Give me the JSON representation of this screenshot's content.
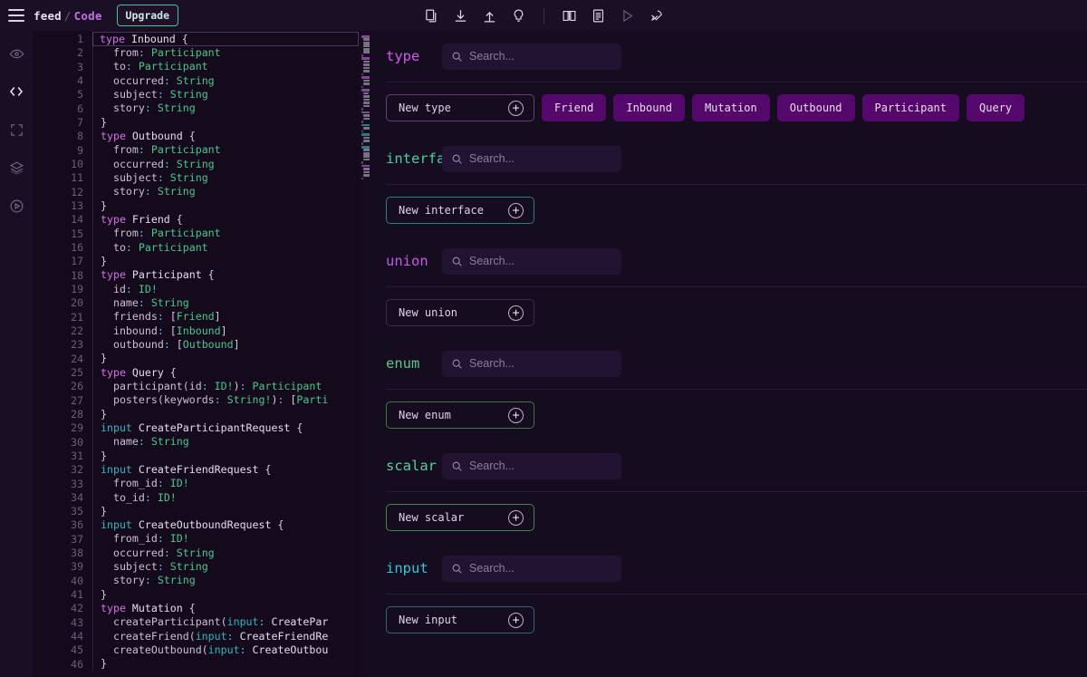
{
  "topbar": {
    "breadcrumb": {
      "project": "feed",
      "separator": "/",
      "current": "Code"
    },
    "upgrade_label": "Upgrade",
    "icons": [
      {
        "name": "copy-icon",
        "title": "Copy"
      },
      {
        "name": "download-icon",
        "title": "Download"
      },
      {
        "name": "upload-icon",
        "title": "Upload"
      },
      {
        "name": "lightbulb-icon",
        "title": "Ideas"
      },
      {
        "name": "book-icon",
        "title": "Docs"
      },
      {
        "name": "file-icon",
        "title": "File"
      },
      {
        "name": "play-icon",
        "title": "Run"
      },
      {
        "name": "rocket-icon",
        "title": "Deploy"
      }
    ]
  },
  "rail": {
    "items": [
      {
        "name": "preview-eye-icon",
        "active": false
      },
      {
        "name": "code-brackets-icon",
        "active": true
      },
      {
        "name": "expand-frame-icon",
        "active": false
      },
      {
        "name": "layers-icon",
        "active": false
      },
      {
        "name": "play-circle-icon",
        "active": false
      }
    ]
  },
  "editor": {
    "first_line": 1,
    "last_line": 46,
    "active_line": 1,
    "lines": [
      {
        "n": 1,
        "tokens": [
          [
            "k-type",
            "type"
          ],
          [
            "pn",
            " "
          ],
          [
            "nm",
            "Inbound"
          ],
          [
            "pn",
            " {"
          ]
        ]
      },
      {
        "n": 2,
        "tokens": [
          [
            "fld",
            "  from"
          ],
          [
            "col",
            ":"
          ],
          [
            "ty",
            " Participant"
          ]
        ]
      },
      {
        "n": 3,
        "tokens": [
          [
            "fld",
            "  to"
          ],
          [
            "col",
            ":"
          ],
          [
            "ty",
            " Participant"
          ]
        ]
      },
      {
        "n": 4,
        "tokens": [
          [
            "fld",
            "  occurred"
          ],
          [
            "col",
            ":"
          ],
          [
            "ty",
            " String"
          ]
        ]
      },
      {
        "n": 5,
        "tokens": [
          [
            "fld",
            "  subject"
          ],
          [
            "col",
            ":"
          ],
          [
            "ty",
            " String"
          ]
        ]
      },
      {
        "n": 6,
        "tokens": [
          [
            "fld",
            "  story"
          ],
          [
            "col",
            ":"
          ],
          [
            "ty",
            " String"
          ]
        ]
      },
      {
        "n": 7,
        "tokens": [
          [
            "pn",
            "}"
          ]
        ]
      },
      {
        "n": 8,
        "tokens": [
          [
            "k-type",
            "type"
          ],
          [
            "pn",
            " "
          ],
          [
            "nm",
            "Outbound"
          ],
          [
            "pn",
            " {"
          ]
        ]
      },
      {
        "n": 9,
        "tokens": [
          [
            "fld",
            "  from"
          ],
          [
            "col",
            ":"
          ],
          [
            "ty",
            " Participant"
          ]
        ]
      },
      {
        "n": 10,
        "tokens": [
          [
            "fld",
            "  occurred"
          ],
          [
            "col",
            ":"
          ],
          [
            "ty",
            " String"
          ]
        ]
      },
      {
        "n": 11,
        "tokens": [
          [
            "fld",
            "  subject"
          ],
          [
            "col",
            ":"
          ],
          [
            "ty",
            " String"
          ]
        ]
      },
      {
        "n": 12,
        "tokens": [
          [
            "fld",
            "  story"
          ],
          [
            "col",
            ":"
          ],
          [
            "ty",
            " String"
          ]
        ]
      },
      {
        "n": 13,
        "tokens": [
          [
            "pn",
            "}"
          ]
        ]
      },
      {
        "n": 14,
        "tokens": [
          [
            "k-type",
            "type"
          ],
          [
            "pn",
            " "
          ],
          [
            "nm",
            "Friend"
          ],
          [
            "pn",
            " {"
          ]
        ]
      },
      {
        "n": 15,
        "tokens": [
          [
            "fld",
            "  from"
          ],
          [
            "col",
            ":"
          ],
          [
            "ty",
            " Participant"
          ]
        ]
      },
      {
        "n": 16,
        "tokens": [
          [
            "fld",
            "  to"
          ],
          [
            "col",
            ":"
          ],
          [
            "ty",
            " Participant"
          ]
        ]
      },
      {
        "n": 17,
        "tokens": [
          [
            "pn",
            "}"
          ]
        ]
      },
      {
        "n": 18,
        "tokens": [
          [
            "k-type",
            "type"
          ],
          [
            "pn",
            " "
          ],
          [
            "nm",
            "Participant"
          ],
          [
            "pn",
            " {"
          ]
        ]
      },
      {
        "n": 19,
        "tokens": [
          [
            "fld",
            "  id"
          ],
          [
            "col",
            ":"
          ],
          [
            "ty",
            " ID!"
          ]
        ]
      },
      {
        "n": 20,
        "tokens": [
          [
            "fld",
            "  name"
          ],
          [
            "col",
            ":"
          ],
          [
            "ty",
            " String"
          ]
        ]
      },
      {
        "n": 21,
        "tokens": [
          [
            "fld",
            "  friends"
          ],
          [
            "col",
            ":"
          ],
          [
            "pn",
            " ["
          ],
          [
            "ty",
            "Friend"
          ],
          [
            "pn",
            "]"
          ]
        ]
      },
      {
        "n": 22,
        "tokens": [
          [
            "fld",
            "  inbound"
          ],
          [
            "col",
            ":"
          ],
          [
            "pn",
            " ["
          ],
          [
            "ty",
            "Inbound"
          ],
          [
            "pn",
            "]"
          ]
        ]
      },
      {
        "n": 23,
        "tokens": [
          [
            "fld",
            "  outbound"
          ],
          [
            "col",
            ":"
          ],
          [
            "pn",
            " ["
          ],
          [
            "ty",
            "Outbound"
          ],
          [
            "pn",
            "]"
          ]
        ]
      },
      {
        "n": 24,
        "tokens": [
          [
            "pn",
            "}"
          ]
        ]
      },
      {
        "n": 25,
        "tokens": [
          [
            "k-type",
            "type"
          ],
          [
            "pn",
            " "
          ],
          [
            "nm",
            "Query"
          ],
          [
            "pn",
            " {"
          ]
        ]
      },
      {
        "n": 26,
        "tokens": [
          [
            "fld",
            "  participant("
          ],
          [
            "fld",
            "id"
          ],
          [
            "col",
            ":"
          ],
          [
            "ty",
            " ID!"
          ],
          [
            "pn",
            ")"
          ],
          [
            "col",
            ":"
          ],
          [
            "ty",
            " Participant"
          ]
        ]
      },
      {
        "n": 27,
        "tokens": [
          [
            "fld",
            "  posters("
          ],
          [
            "fld",
            "keywords"
          ],
          [
            "col",
            ":"
          ],
          [
            "ty",
            " String!"
          ],
          [
            "pn",
            ")"
          ],
          [
            "col",
            ":"
          ],
          [
            "pn",
            " ["
          ],
          [
            "ty",
            "Parti"
          ]
        ]
      },
      {
        "n": 28,
        "tokens": [
          [
            "pn",
            "}"
          ]
        ]
      },
      {
        "n": 29,
        "tokens": [
          [
            "k-input",
            "input"
          ],
          [
            "pn",
            " "
          ],
          [
            "nm",
            "CreateParticipantRequest"
          ],
          [
            "pn",
            " {"
          ]
        ]
      },
      {
        "n": 30,
        "tokens": [
          [
            "fld",
            "  name"
          ],
          [
            "col",
            ":"
          ],
          [
            "ty",
            " String"
          ]
        ]
      },
      {
        "n": 31,
        "tokens": [
          [
            "pn",
            "}"
          ]
        ]
      },
      {
        "n": 32,
        "tokens": [
          [
            "k-input",
            "input"
          ],
          [
            "pn",
            " "
          ],
          [
            "nm",
            "CreateFriendRequest"
          ],
          [
            "pn",
            " {"
          ]
        ]
      },
      {
        "n": 33,
        "tokens": [
          [
            "fld",
            "  from_id"
          ],
          [
            "col",
            ":"
          ],
          [
            "ty",
            " ID!"
          ]
        ]
      },
      {
        "n": 34,
        "tokens": [
          [
            "fld",
            "  to_id"
          ],
          [
            "col",
            ":"
          ],
          [
            "ty",
            " ID!"
          ]
        ]
      },
      {
        "n": 35,
        "tokens": [
          [
            "pn",
            "}"
          ]
        ]
      },
      {
        "n": 36,
        "tokens": [
          [
            "k-input",
            "input"
          ],
          [
            "pn",
            " "
          ],
          [
            "nm",
            "CreateOutboundRequest"
          ],
          [
            "pn",
            " {"
          ]
        ]
      },
      {
        "n": 37,
        "tokens": [
          [
            "fld",
            "  from_id"
          ],
          [
            "col",
            ":"
          ],
          [
            "ty",
            " ID!"
          ]
        ]
      },
      {
        "n": 38,
        "tokens": [
          [
            "fld",
            "  occurred"
          ],
          [
            "col",
            ":"
          ],
          [
            "ty",
            " String"
          ]
        ]
      },
      {
        "n": 39,
        "tokens": [
          [
            "fld",
            "  subject"
          ],
          [
            "col",
            ":"
          ],
          [
            "ty",
            " String"
          ]
        ]
      },
      {
        "n": 40,
        "tokens": [
          [
            "fld",
            "  story"
          ],
          [
            "col",
            ":"
          ],
          [
            "ty",
            " String"
          ]
        ]
      },
      {
        "n": 41,
        "tokens": [
          [
            "pn",
            "}"
          ]
        ]
      },
      {
        "n": 42,
        "tokens": [
          [
            "k-type",
            "type"
          ],
          [
            "pn",
            " "
          ],
          [
            "nm",
            "Mutation"
          ],
          [
            "pn",
            " {"
          ]
        ]
      },
      {
        "n": 43,
        "tokens": [
          [
            "fld",
            "  createParticipant("
          ],
          [
            "k-input",
            "input"
          ],
          [
            "col",
            ":"
          ],
          [
            "nm",
            " CreatePar"
          ]
        ]
      },
      {
        "n": 44,
        "tokens": [
          [
            "fld",
            "  createFriend("
          ],
          [
            "k-input",
            "input"
          ],
          [
            "col",
            ":"
          ],
          [
            "nm",
            " CreateFriendRe"
          ]
        ]
      },
      {
        "n": 45,
        "tokens": [
          [
            "fld",
            "  createOutbound("
          ],
          [
            "k-input",
            "input"
          ],
          [
            "col",
            ":"
          ],
          [
            "nm",
            " CreateOutbou"
          ]
        ]
      },
      {
        "n": 46,
        "tokens": [
          [
            "pn",
            "}"
          ]
        ]
      }
    ]
  },
  "panel": {
    "search_placeholder": "Search...",
    "sections": [
      {
        "key": "type",
        "label": "type",
        "label_color": "#d25ae8",
        "accent": "#6a3a7d",
        "new_label": "New type",
        "chips": [
          "Friend",
          "Inbound",
          "Mutation",
          "Outbound",
          "Participant",
          "Query"
        ],
        "search_width": 198
      },
      {
        "key": "interface",
        "label": "interface",
        "label_color": "#49cf9c",
        "accent": "#2c7f76",
        "new_label": "New interface",
        "chips": [],
        "search_width": 198
      },
      {
        "key": "union",
        "label": "union",
        "label_color": "#c45ae8",
        "accent": "#3b2a4d",
        "new_label": "New union",
        "chips": [],
        "search_width": 198
      },
      {
        "key": "enum",
        "label": "enum",
        "label_color": "#58c98a",
        "accent": "#3d7a3a",
        "new_label": "New enum",
        "chips": [],
        "search_width": 198
      },
      {
        "key": "scalar",
        "label": "scalar",
        "label_color": "#4fd39a",
        "accent": "#3d8a4a",
        "new_label": "New scalar",
        "chips": [],
        "search_width": 198
      },
      {
        "key": "input",
        "label": "input",
        "label_color": "#2fc8d4",
        "accent": "#2a6a78",
        "new_label": "New input",
        "chips": [],
        "search_width": 198
      }
    ]
  }
}
